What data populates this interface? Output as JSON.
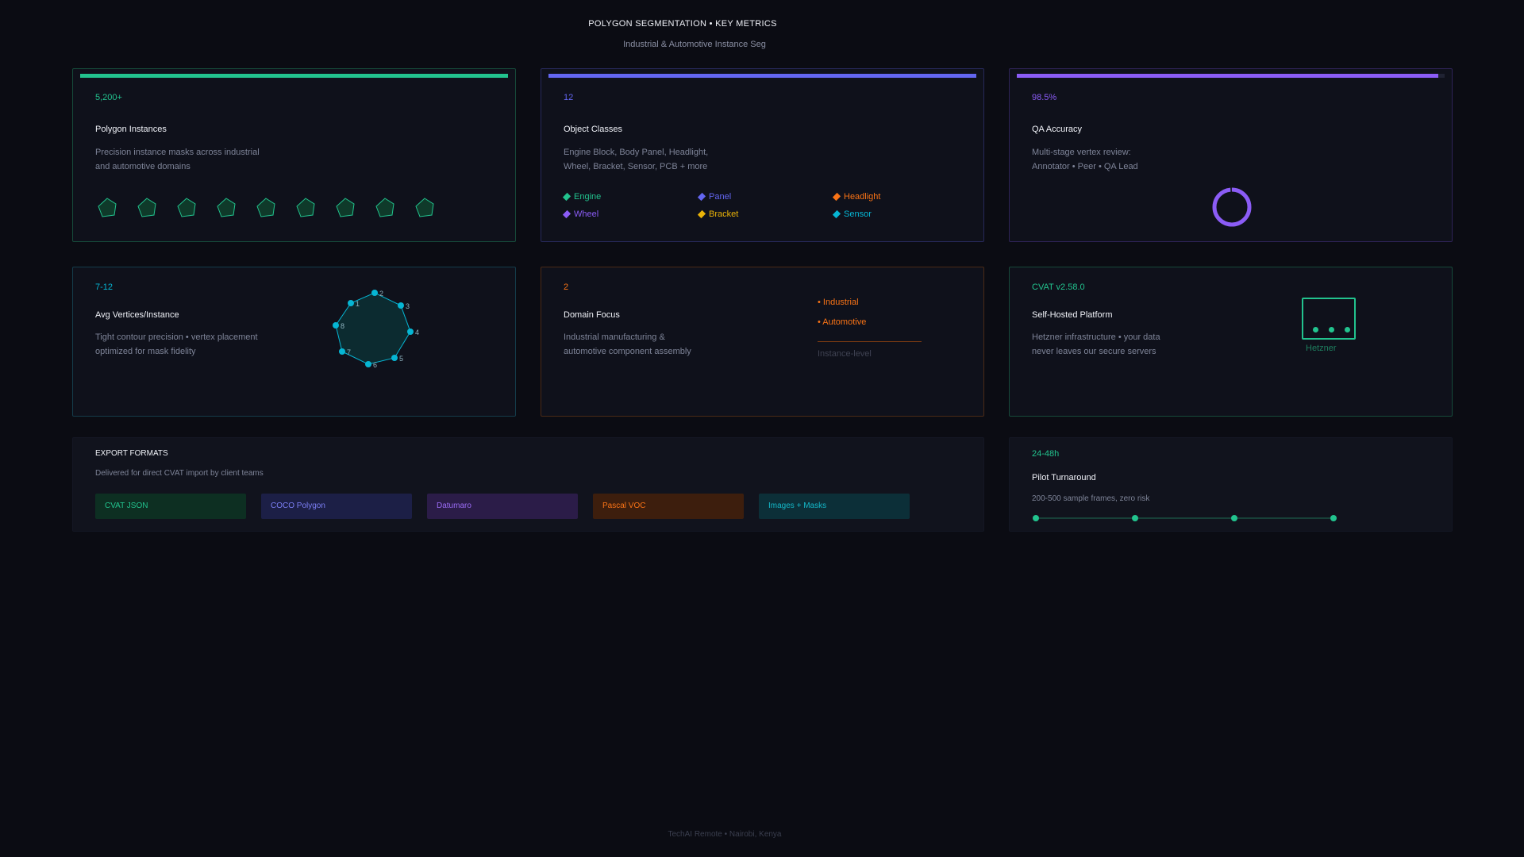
{
  "header": {
    "title": "POLYGON SEGMENTATION • KEY METRICS",
    "subtitle": "Industrial & Automotive Instance Seg"
  },
  "cards": {
    "instances": {
      "metric": "5,200+",
      "title": "Polygon Instances",
      "desc": [
        "Precision instance masks across industrial",
        "and automotive domains"
      ],
      "accent": "#22c38e",
      "progress": 1.0,
      "hex_count": 9
    },
    "classes": {
      "metric": "12",
      "title": "Object Classes",
      "desc": [
        "Engine Block, Body Panel, Headlight,",
        "Wheel, Bracket, Sensor, PCB + more"
      ],
      "accent": "#6366f1",
      "progress": 1.0,
      "legend": [
        {
          "label": "Engine",
          "color": "#22c38e"
        },
        {
          "label": "Panel",
          "color": "#6366f1"
        },
        {
          "label": "Headlight",
          "color": "#f97316"
        },
        {
          "label": "Wheel",
          "color": "#8b5cf6"
        },
        {
          "label": "Bracket",
          "color": "#eab308"
        },
        {
          "label": "Sensor",
          "color": "#06b6d4"
        }
      ]
    },
    "accuracy": {
      "metric": "98.5%",
      "title": "QA Accuracy",
      "desc": [
        "Multi-stage vertex review:",
        "Annotator • Peer • QA Lead"
      ],
      "accent": "#8b5cf6",
      "progress": 0.985
    },
    "vertices": {
      "metric": "7-12",
      "title": "Avg Vertices/Instance",
      "desc": [
        "Tight contour precision • vertex placement",
        "optimized for mask fidelity"
      ],
      "accent": "#06b6d4",
      "vertex_labels": [
        "1",
        "2",
        "3",
        "4",
        "5",
        "6",
        "7",
        "8"
      ]
    },
    "domain": {
      "metric": "2",
      "title": "Domain Focus",
      "desc": [
        "Industrial manufacturing &",
        "automotive component assembly"
      ],
      "accent": "#f97316",
      "items": [
        "• Industrial",
        "• Automotive"
      ],
      "note": "Instance-level"
    },
    "platform": {
      "metric": "CVAT v2.58.0",
      "title": "Self-Hosted Platform",
      "desc": [
        "Hetzner infrastructure • your data",
        "never leaves our secure servers"
      ],
      "accent": "#22c38e",
      "server_label": "Hetzner"
    },
    "export": {
      "title": "EXPORT FORMATS",
      "desc": "Delivered for direct CVAT import by client teams",
      "formats": [
        {
          "label": "CVAT JSON",
          "bg": "#0d2f22",
          "fg": "#22c38e"
        },
        {
          "label": "COCO Polygon",
          "bg": "#1c1f46",
          "fg": "#7c7ff5"
        },
        {
          "label": "Datumaro",
          "bg": "#2b1c48",
          "fg": "#9b6cf6"
        },
        {
          "label": "Pascal VOC",
          "bg": "#3d1e0d",
          "fg": "#f97316"
        },
        {
          "label": "Images + Masks",
          "bg": "#0c2f38",
          "fg": "#14b8c9"
        }
      ]
    },
    "pilot": {
      "metric": "24-48h",
      "title": "Pilot Turnaround",
      "desc": "200-500 sample frames, zero risk",
      "accent": "#22c38e"
    }
  },
  "footer": "TechAI Remote • Nairobi, Kenya"
}
